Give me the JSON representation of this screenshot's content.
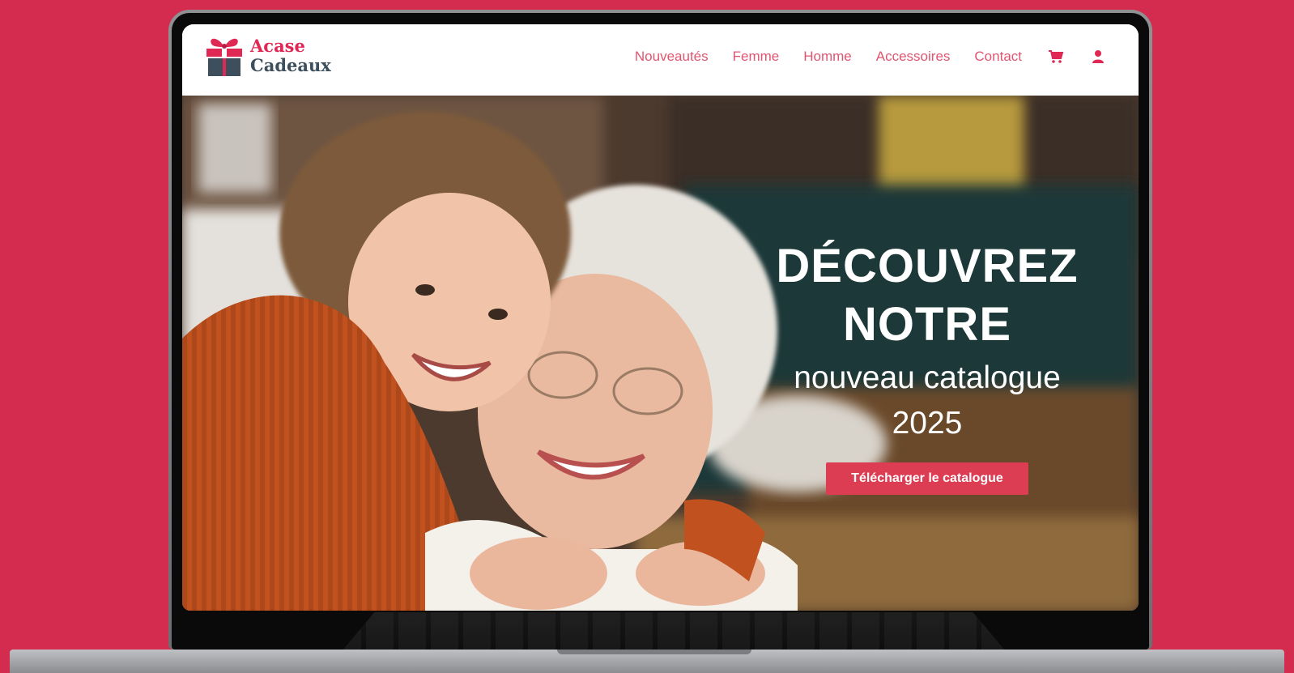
{
  "brand": {
    "name_line1": "Acase",
    "name_line2": "Cadeaux"
  },
  "nav": {
    "items": [
      {
        "label": "Nouveautés"
      },
      {
        "label": "Femme"
      },
      {
        "label": "Homme"
      },
      {
        "label": "Accessoires"
      },
      {
        "label": "Contact"
      }
    ],
    "icons": [
      "cart-icon",
      "user-icon"
    ]
  },
  "hero": {
    "title_line1": "DÉCOUVREZ",
    "title_line2": "NOTRE",
    "subtitle_line1": "nouveau catalogue",
    "subtitle_line2": "2025",
    "cta_label": "Télécharger le catalogue"
  },
  "colors": {
    "background": "#d32c4f",
    "accent": "#dc3d52",
    "logo_red": "#e02855",
    "logo_slate": "#3d4f5c",
    "nav_text": "#e05570"
  }
}
